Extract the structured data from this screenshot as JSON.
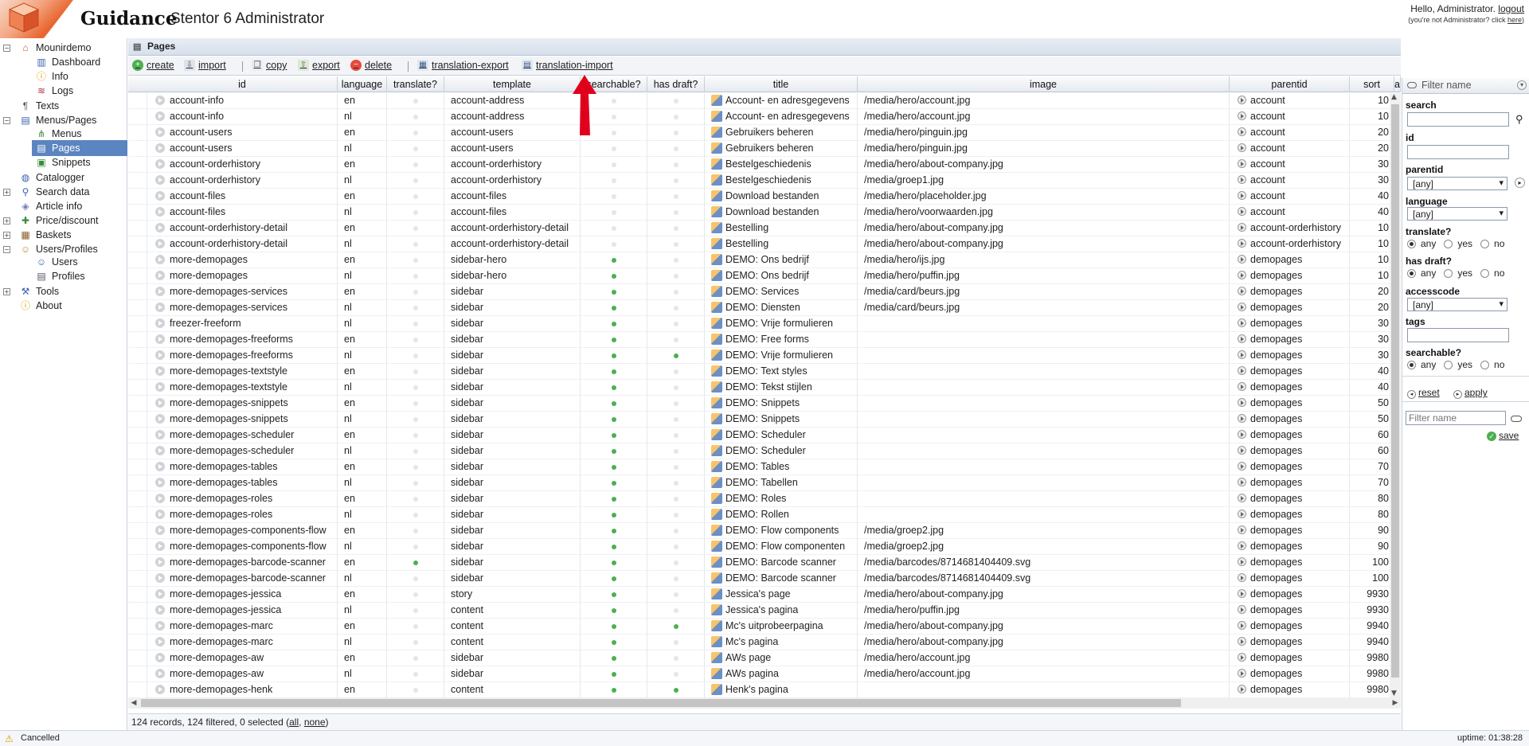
{
  "header": {
    "brand": "Guidance",
    "subtitle": "Stentor 6 Administrator",
    "greeting": "Hello, Administrator.",
    "logout": "logout",
    "not_admin_prefix": "(you're not Administrator? click ",
    "not_admin_link": "here",
    "not_admin_suffix": ")"
  },
  "sidebar": {
    "items": [
      {
        "label": "Mounirdemo",
        "icon": "home-icon",
        "toggle": "−"
      },
      {
        "label": "Dashboard",
        "icon": "chart-icon"
      },
      {
        "label": "Info",
        "icon": "info-icon"
      },
      {
        "label": "Logs",
        "icon": "log-icon"
      },
      {
        "label": "Texts",
        "icon": "text-icon"
      },
      {
        "label": "Menus/Pages",
        "icon": "menu-icon",
        "toggle": "−"
      },
      {
        "label": "Menus",
        "icon": "tree-icon"
      },
      {
        "label": "Pages",
        "icon": "pages-icon",
        "selected": true
      },
      {
        "label": "Snippets",
        "icon": "snippet-icon"
      },
      {
        "label": "Catalogger",
        "icon": "catalog-icon"
      },
      {
        "label": "Search data",
        "icon": "search-icon",
        "toggle": "+"
      },
      {
        "label": "Article info",
        "icon": "tag-icon"
      },
      {
        "label": "Price/discount",
        "icon": "price-icon",
        "toggle": "+"
      },
      {
        "label": "Baskets",
        "icon": "basket-icon",
        "toggle": "+"
      },
      {
        "label": "Users/Profiles",
        "icon": "users-icon",
        "toggle": "−"
      },
      {
        "label": "Users",
        "icon": "user-icon"
      },
      {
        "label": "Profiles",
        "icon": "profile-icon"
      },
      {
        "label": "Tools",
        "icon": "tools-icon",
        "toggle": "+"
      },
      {
        "label": "About",
        "icon": "info-icon"
      }
    ]
  },
  "panel": {
    "title": "Pages"
  },
  "toolbar": {
    "create": "create",
    "import": "import",
    "copy": "copy",
    "export": "export",
    "delete": "delete",
    "translation_export": "translation-export",
    "translation_import": "translation-import"
  },
  "grid": {
    "columns": [
      "id",
      "language",
      "translate?",
      "template",
      "searchable?",
      "has draft?",
      "title",
      "image",
      "parentid",
      "sort",
      "a"
    ],
    "rows": [
      {
        "id": "account-info",
        "language": "en",
        "translate": false,
        "template": "account-address",
        "searchable": false,
        "draft": false,
        "title": "Account- en adresgegevens",
        "image": "/media/hero/account.jpg",
        "parentid": "account",
        "sort": "10"
      },
      {
        "id": "account-info",
        "language": "nl",
        "translate": false,
        "template": "account-address",
        "searchable": false,
        "draft": false,
        "title": "Account- en adresgegevens",
        "image": "/media/hero/account.jpg",
        "parentid": "account",
        "sort": "10"
      },
      {
        "id": "account-users",
        "language": "en",
        "translate": false,
        "template": "account-users",
        "searchable": false,
        "draft": false,
        "title": "Gebruikers beheren",
        "image": "/media/hero/pinguin.jpg",
        "parentid": "account",
        "sort": "20"
      },
      {
        "id": "account-users",
        "language": "nl",
        "translate": false,
        "template": "account-users",
        "searchable": false,
        "draft": false,
        "title": "Gebruikers beheren",
        "image": "/media/hero/pinguin.jpg",
        "parentid": "account",
        "sort": "20"
      },
      {
        "id": "account-orderhistory",
        "language": "en",
        "translate": false,
        "template": "account-orderhistory",
        "searchable": false,
        "draft": false,
        "title": "Bestelgeschiedenis",
        "image": "/media/hero/about-company.jpg",
        "parentid": "account",
        "sort": "30"
      },
      {
        "id": "account-orderhistory",
        "language": "nl",
        "translate": false,
        "template": "account-orderhistory",
        "searchable": false,
        "draft": false,
        "title": "Bestelgeschiedenis",
        "image": "/media/groep1.jpg",
        "parentid": "account",
        "sort": "30"
      },
      {
        "id": "account-files",
        "language": "en",
        "translate": false,
        "template": "account-files",
        "searchable": false,
        "draft": false,
        "title": "Download bestanden",
        "image": "/media/hero/placeholder.jpg",
        "parentid": "account",
        "sort": "40"
      },
      {
        "id": "account-files",
        "language": "nl",
        "translate": false,
        "template": "account-files",
        "searchable": false,
        "draft": false,
        "title": "Download bestanden",
        "image": "/media/hero/voorwaarden.jpg",
        "parentid": "account",
        "sort": "40"
      },
      {
        "id": "account-orderhistory-detail",
        "language": "en",
        "translate": false,
        "template": "account-orderhistory-detail",
        "searchable": false,
        "draft": false,
        "title": "Bestelling",
        "image": "/media/hero/about-company.jpg",
        "parentid": "account-orderhistory",
        "sort": "10"
      },
      {
        "id": "account-orderhistory-detail",
        "language": "nl",
        "translate": false,
        "template": "account-orderhistory-detail",
        "searchable": false,
        "draft": false,
        "title": "Bestelling",
        "image": "/media/hero/about-company.jpg",
        "parentid": "account-orderhistory",
        "sort": "10"
      },
      {
        "id": "more-demopages",
        "language": "en",
        "translate": false,
        "template": "sidebar-hero",
        "searchable": true,
        "draft": false,
        "title": "DEMO: Ons bedrijf",
        "image": "/media/hero/ijs.jpg",
        "parentid": "demopages",
        "sort": "10"
      },
      {
        "id": "more-demopages",
        "language": "nl",
        "translate": false,
        "template": "sidebar-hero",
        "searchable": true,
        "draft": false,
        "title": "DEMO: Ons bedrijf",
        "image": "/media/hero/puffin.jpg",
        "parentid": "demopages",
        "sort": "10"
      },
      {
        "id": "more-demopages-services",
        "language": "en",
        "translate": false,
        "template": "sidebar",
        "searchable": true,
        "draft": false,
        "title": "DEMO: Services",
        "image": "/media/card/beurs.jpg",
        "parentid": "demopages",
        "sort": "20"
      },
      {
        "id": "more-demopages-services",
        "language": "nl",
        "translate": false,
        "template": "sidebar",
        "searchable": true,
        "draft": false,
        "title": "DEMO: Diensten",
        "image": "/media/card/beurs.jpg",
        "parentid": "demopages",
        "sort": "20"
      },
      {
        "id": "freezer-freeform",
        "language": "nl",
        "translate": false,
        "template": "sidebar",
        "searchable": true,
        "draft": false,
        "title": "DEMO: Vrije formulieren",
        "image": "",
        "parentid": "demopages",
        "sort": "30"
      },
      {
        "id": "more-demopages-freeforms",
        "language": "en",
        "translate": false,
        "template": "sidebar",
        "searchable": true,
        "draft": false,
        "title": "DEMO: Free forms",
        "image": "",
        "parentid": "demopages",
        "sort": "30"
      },
      {
        "id": "more-demopages-freeforms",
        "language": "nl",
        "translate": false,
        "template": "sidebar",
        "searchable": true,
        "draft": true,
        "title": "DEMO: Vrije formulieren",
        "image": "",
        "parentid": "demopages",
        "sort": "30"
      },
      {
        "id": "more-demopages-textstyle",
        "language": "en",
        "translate": false,
        "template": "sidebar",
        "searchable": true,
        "draft": false,
        "title": "DEMO: Text styles",
        "image": "",
        "parentid": "demopages",
        "sort": "40"
      },
      {
        "id": "more-demopages-textstyle",
        "language": "nl",
        "translate": false,
        "template": "sidebar",
        "searchable": true,
        "draft": false,
        "title": "DEMO: Tekst stijlen",
        "image": "",
        "parentid": "demopages",
        "sort": "40"
      },
      {
        "id": "more-demopages-snippets",
        "language": "en",
        "translate": false,
        "template": "sidebar",
        "searchable": true,
        "draft": false,
        "title": "DEMO: Snippets",
        "image": "",
        "parentid": "demopages",
        "sort": "50"
      },
      {
        "id": "more-demopages-snippets",
        "language": "nl",
        "translate": false,
        "template": "sidebar",
        "searchable": true,
        "draft": false,
        "title": "DEMO: Snippets",
        "image": "",
        "parentid": "demopages",
        "sort": "50"
      },
      {
        "id": "more-demopages-scheduler",
        "language": "en",
        "translate": false,
        "template": "sidebar",
        "searchable": true,
        "draft": false,
        "title": "DEMO: Scheduler",
        "image": "",
        "parentid": "demopages",
        "sort": "60"
      },
      {
        "id": "more-demopages-scheduler",
        "language": "nl",
        "translate": false,
        "template": "sidebar",
        "searchable": true,
        "draft": false,
        "title": "DEMO: Scheduler",
        "image": "",
        "parentid": "demopages",
        "sort": "60"
      },
      {
        "id": "more-demopages-tables",
        "language": "en",
        "translate": false,
        "template": "sidebar",
        "searchable": true,
        "draft": false,
        "title": "DEMO: Tables",
        "image": "",
        "parentid": "demopages",
        "sort": "70"
      },
      {
        "id": "more-demopages-tables",
        "language": "nl",
        "translate": false,
        "template": "sidebar",
        "searchable": true,
        "draft": false,
        "title": "DEMO: Tabellen",
        "image": "",
        "parentid": "demopages",
        "sort": "70"
      },
      {
        "id": "more-demopages-roles",
        "language": "en",
        "translate": false,
        "template": "sidebar",
        "searchable": true,
        "draft": false,
        "title": "DEMO: Roles",
        "image": "",
        "parentid": "demopages",
        "sort": "80"
      },
      {
        "id": "more-demopages-roles",
        "language": "nl",
        "translate": false,
        "template": "sidebar",
        "searchable": true,
        "draft": false,
        "title": "DEMO: Rollen",
        "image": "",
        "parentid": "demopages",
        "sort": "80"
      },
      {
        "id": "more-demopages-components-flow",
        "language": "en",
        "translate": false,
        "template": "sidebar",
        "searchable": true,
        "draft": false,
        "title": "DEMO: Flow components",
        "image": "/media/groep2.jpg",
        "parentid": "demopages",
        "sort": "90"
      },
      {
        "id": "more-demopages-components-flow",
        "language": "nl",
        "translate": false,
        "template": "sidebar",
        "searchable": true,
        "draft": false,
        "title": "DEMO: Flow componenten",
        "image": "/media/groep2.jpg",
        "parentid": "demopages",
        "sort": "90"
      },
      {
        "id": "more-demopages-barcode-scanner",
        "language": "en",
        "translate": true,
        "template": "sidebar",
        "searchable": true,
        "draft": false,
        "title": "DEMO: Barcode scanner",
        "image": "/media/barcodes/8714681404409.svg",
        "parentid": "demopages",
        "sort": "100"
      },
      {
        "id": "more-demopages-barcode-scanner",
        "language": "nl",
        "translate": false,
        "template": "sidebar",
        "searchable": true,
        "draft": false,
        "title": "DEMO: Barcode scanner",
        "image": "/media/barcodes/8714681404409.svg",
        "parentid": "demopages",
        "sort": "100"
      },
      {
        "id": "more-demopages-jessica",
        "language": "en",
        "translate": false,
        "template": "story",
        "searchable": true,
        "draft": false,
        "title": "Jessica's page",
        "image": "/media/hero/about-company.jpg",
        "parentid": "demopages",
        "sort": "9930"
      },
      {
        "id": "more-demopages-jessica",
        "language": "nl",
        "translate": false,
        "template": "content",
        "searchable": true,
        "draft": false,
        "title": "Jessica's pagina",
        "image": "/media/hero/puffin.jpg",
        "parentid": "demopages",
        "sort": "9930"
      },
      {
        "id": "more-demopages-marc",
        "language": "en",
        "translate": false,
        "template": "content",
        "searchable": true,
        "draft": true,
        "title": "Mc's uitprobeerpagina",
        "image": "/media/hero/about-company.jpg",
        "parentid": "demopages",
        "sort": "9940"
      },
      {
        "id": "more-demopages-marc",
        "language": "nl",
        "translate": false,
        "template": "content",
        "searchable": true,
        "draft": false,
        "title": "Mc's pagina",
        "image": "/media/hero/about-company.jpg",
        "parentid": "demopages",
        "sort": "9940"
      },
      {
        "id": "more-demopages-aw",
        "language": "en",
        "translate": false,
        "template": "sidebar",
        "searchable": true,
        "draft": false,
        "title": "AWs page",
        "image": "/media/hero/account.jpg",
        "parentid": "demopages",
        "sort": "9980"
      },
      {
        "id": "more-demopages-aw",
        "language": "nl",
        "translate": false,
        "template": "sidebar",
        "searchable": true,
        "draft": false,
        "title": "AWs pagina",
        "image": "/media/hero/account.jpg",
        "parentid": "demopages",
        "sort": "9980"
      },
      {
        "id": "more-demopages-henk",
        "language": "en",
        "translate": false,
        "template": "content",
        "searchable": true,
        "draft": true,
        "title": "Henk's pagina",
        "image": "",
        "parentid": "demopages",
        "sort": "9980"
      }
    ]
  },
  "status": {
    "summary": "124 records, 124 filtered, 0 selected (",
    "all": "all",
    "sep": ", ",
    "none": "none",
    "close": ")"
  },
  "filter": {
    "header_placeholder": "Filter name",
    "search_label": "search",
    "id_label": "id",
    "parentid_label": "parentid",
    "parentid_value": "[any]",
    "language_label": "language",
    "language_value": "[any]",
    "translate_label": "translate?",
    "hasdraft_label": "has draft?",
    "accesscode_label": "accesscode",
    "accesscode_value": "[any]",
    "tags_label": "tags",
    "searchable_label": "searchable?",
    "opt_any": "any",
    "opt_yes": "yes",
    "opt_no": "no",
    "reset": "reset",
    "apply": "apply",
    "filter_name_placeholder": "Filter name",
    "save": "save"
  },
  "bottom": {
    "status_text": "Cancelled",
    "uptime": "uptime: 01:38:28"
  },
  "colors": {
    "selected_nav": "#5b85c0",
    "arrow_annotation": "#e0001b",
    "on_dot": "#4caf50"
  }
}
